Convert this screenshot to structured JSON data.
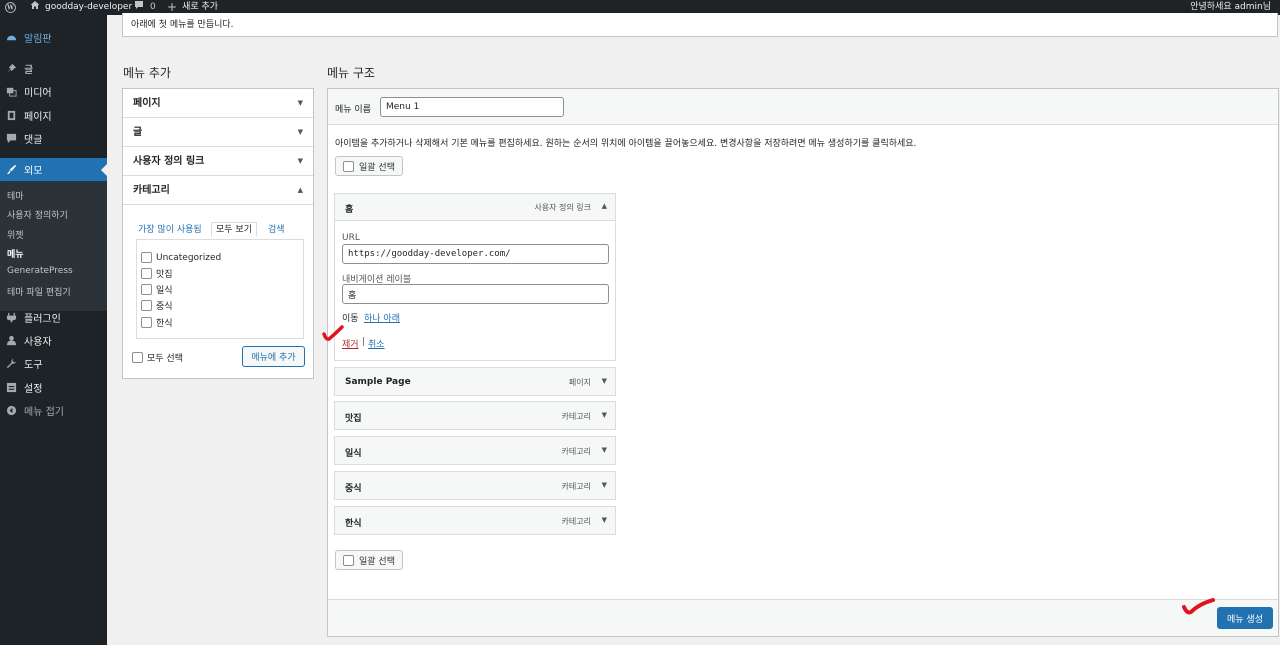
{
  "adminbar": {
    "site_name": "goodday-developer",
    "comments_count": "0",
    "new_label": "새로 추가",
    "greeting": "안녕하세요 admin님"
  },
  "sidebar": {
    "dashboard": "알림판",
    "posts": "글",
    "media": "미디어",
    "pages": "페이지",
    "comments": "댓글",
    "appearance": "외모",
    "appearance_sub": [
      "테마",
      "사용자 정의하기",
      "위젯",
      "메뉴",
      "GeneratePress",
      "테마 파일 편집기"
    ],
    "plugins": "플러그인",
    "users": "사용자",
    "tools": "도구",
    "settings": "설정",
    "collapse": "메뉴 접기"
  },
  "notice": "아래에 첫 메뉴를 만듭니다.",
  "add_menu": {
    "title": "메뉴 추가",
    "sections": [
      "페이지",
      "글",
      "사용자 정의 링크",
      "카테고리"
    ],
    "tabs": [
      "가장 많이 사용됨",
      "모두 보기",
      "검색"
    ],
    "categories": [
      "Uncategorized",
      "맛집",
      "일식",
      "중식",
      "한식"
    ],
    "select_all": "모두 선택",
    "add_button": "메뉴에 추가"
  },
  "menu_structure": {
    "title": "메뉴 구조",
    "name_label": "메뉴 이름",
    "name_value": "Menu 1",
    "instructions": "아이템을 추가하거나 삭제해서 기본 메뉴를 편집하세요. 원하는 순서의 위치에 아이템을 끌어놓으세요. 변경사항을 저장하려면 메뉴 생성하기를 클릭하세요.",
    "bulk_select": "일괄 선택",
    "expanded": {
      "title": "홈",
      "type": "사용자 정의 링크",
      "url_label": "URL",
      "url_value": "https://goodday-developer.com/",
      "nav_label": "내비게이션 레이블",
      "nav_value": "홈",
      "move_label": "이동",
      "move_link": "하나 아래",
      "remove": "제거",
      "cancel": "취소"
    },
    "items": [
      {
        "title": "Sample Page",
        "type": "페이지"
      },
      {
        "title": "맛집",
        "type": "카테고리"
      },
      {
        "title": "일식",
        "type": "카테고리"
      },
      {
        "title": "중식",
        "type": "카테고리"
      },
      {
        "title": "한식",
        "type": "카테고리"
      }
    ],
    "save_button": "메뉴 생성"
  },
  "colors": {
    "accent": "#2271b1",
    "sidebar": "#1d2327",
    "annotation": "#e0161c"
  }
}
